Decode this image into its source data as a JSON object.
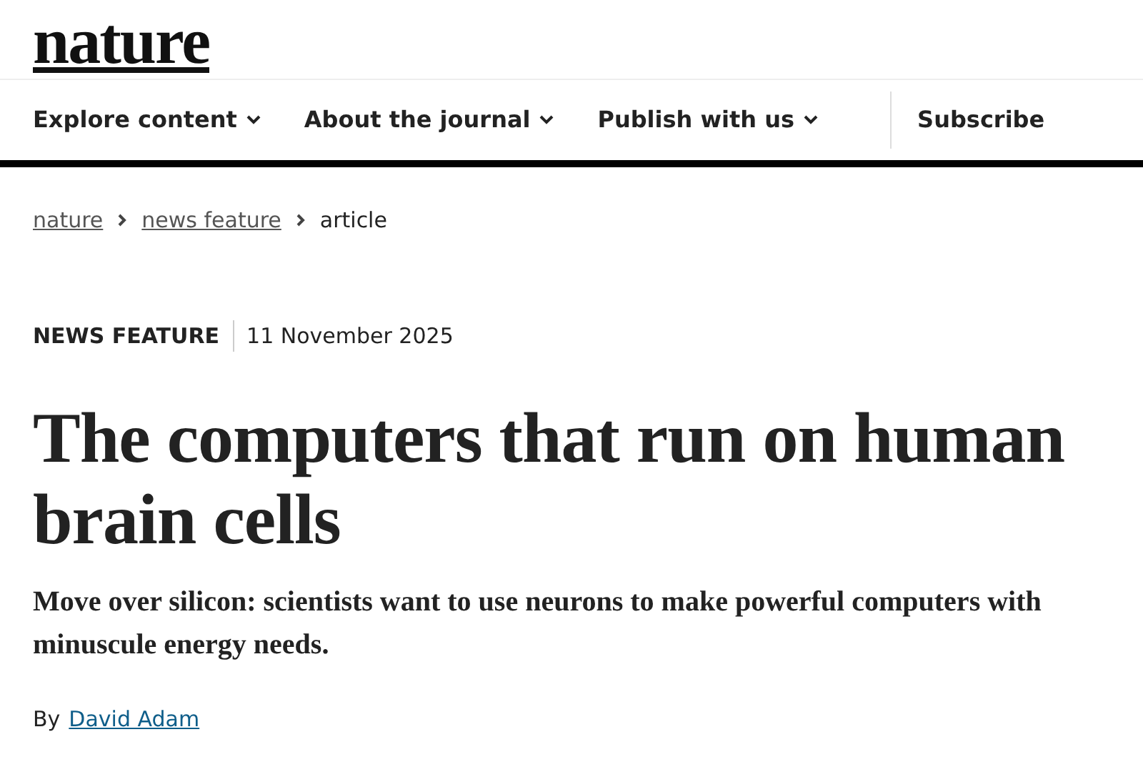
{
  "logo": "nature",
  "nav": [
    {
      "label": "Explore content",
      "dropdown": true
    },
    {
      "label": "About the journal",
      "dropdown": true
    },
    {
      "label": "Publish with us",
      "dropdown": true
    },
    {
      "label": "Subscribe",
      "dropdown": false
    }
  ],
  "breadcrumbs": [
    {
      "label": "nature",
      "link": true
    },
    {
      "label": "news feature",
      "link": true
    },
    {
      "label": "article",
      "link": false
    }
  ],
  "article_type": "NEWS FEATURE",
  "date": "11 November 2025",
  "title": "The computers that run on human brain cells",
  "standfirst": "Move over silicon: scientists want to use neurons to make powerful computers with minuscule energy needs.",
  "byline": {
    "prefix": "By",
    "author": "David Adam"
  }
}
